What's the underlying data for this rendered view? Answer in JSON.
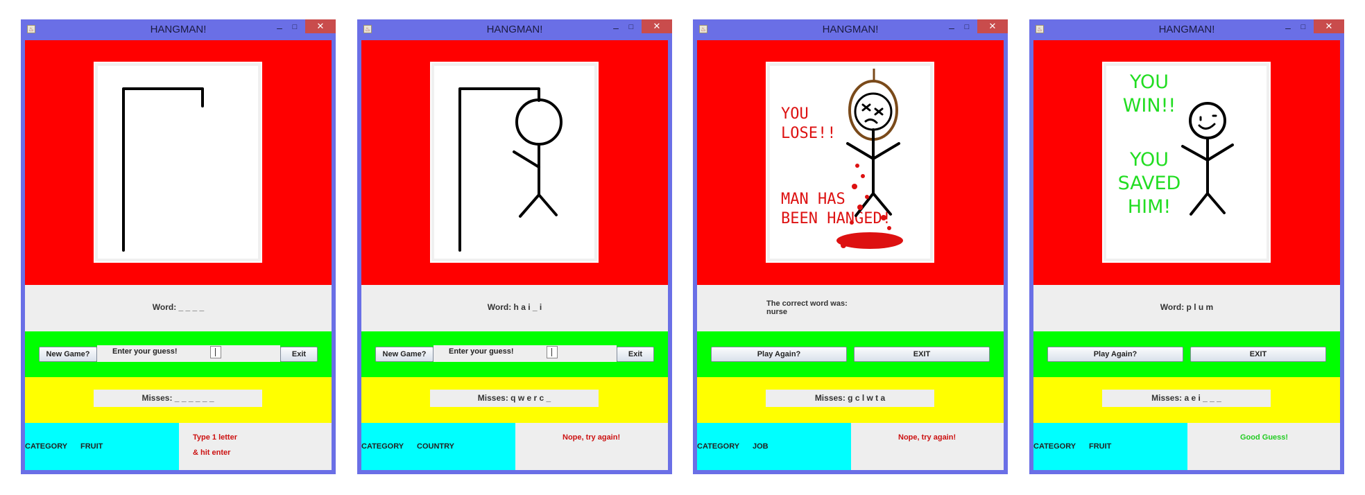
{
  "colors": {
    "window_frame": "#6a6fe6",
    "image_panel": "#ff0000",
    "button_panel": "#00ff00",
    "misses_panel": "#ffff00",
    "category_panel": "#00ffff",
    "close_button": "#c94c4c",
    "lose_text": "#dd1111",
    "win_text": "#22dd22"
  },
  "windows": [
    {
      "title": "HANGMAN!",
      "state": "start",
      "word": "Word:  _  _  _  _",
      "buttons": {
        "new_game": "New Game?",
        "guess_label": "Enter your guess!",
        "exit": "Exit"
      },
      "misses": "Misses:  _  _  _  _  _  _",
      "category_label": "CATEGORY",
      "category_value": "FRUIT",
      "message_line1": "Type 1 letter",
      "message_line2": "& hit enter",
      "message_color": "#cc1111"
    },
    {
      "title": "HANGMAN!",
      "state": "playing",
      "word": "Word: h  a  i  _  i",
      "buttons": {
        "new_game": "New Game?",
        "guess_label": "Enter your guess!",
        "exit": "Exit"
      },
      "misses": "Misses: q  w  e  r  c  _",
      "category_label": "CATEGORY",
      "category_value": "COUNTRY",
      "message": "Nope, try again!",
      "message_color": "#cc1111"
    },
    {
      "title": "HANGMAN!",
      "state": "lose",
      "correct_line1": "The correct word was:",
      "correct_line2": "nurse",
      "buttons": {
        "play_again": "Play Again?",
        "exit": "EXIT"
      },
      "misses": "Misses: g  c  l  w  t  a",
      "category_label": "CATEGORY",
      "category_value": "JOB",
      "message": "Nope, try again!",
      "message_color": "#cc1111",
      "image_text": {
        "line1": "YOU",
        "line2": "LOSE!!",
        "line3": "MAN HAS",
        "line4": "BEEN HANGED!"
      }
    },
    {
      "title": "HANGMAN!",
      "state": "win",
      "word": "Word: p  l  u  m",
      "buttons": {
        "play_again": "Play Again?",
        "exit": "EXIT"
      },
      "misses": "Misses: a  e  i  _  _  _",
      "category_label": "CATEGORY",
      "category_value": "FRUIT",
      "message": "Good Guess!",
      "message_color": "#22cc22",
      "image_text": {
        "line1": "YOU",
        "line2": "WIN!!",
        "line3": "YOU",
        "line4": "SAVED",
        "line5": "HIM!"
      }
    }
  ]
}
